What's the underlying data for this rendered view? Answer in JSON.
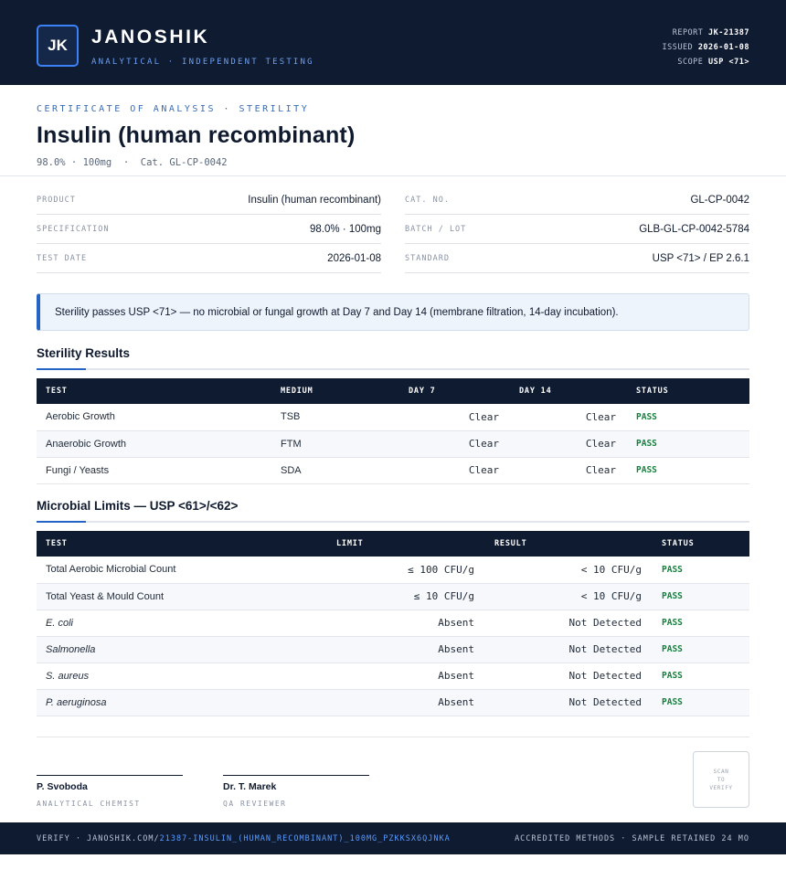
{
  "brand": {
    "logo_text": "JK",
    "name": "JANOSHIK",
    "tagline": "ANALYTICAL · INDEPENDENT TESTING"
  },
  "report_meta": [
    {
      "label": "REPORT",
      "value": "JK-21387"
    },
    {
      "label": "ISSUED",
      "value": "2026-01-08"
    },
    {
      "label": "SCOPE",
      "value": "USP <71>"
    }
  ],
  "certificate": {
    "eyebrow": "CERTIFICATE OF ANALYSIS · STERILITY",
    "title": "Insulin (human recombinant)",
    "subtitle": "98.0% · 100mg  ·  Cat. GL-CP-0042"
  },
  "info": {
    "left": [
      {
        "label": "PRODUCT",
        "value": "Insulin (human recombinant)"
      },
      {
        "label": "SPECIFICATION",
        "value": "98.0% · 100mg"
      },
      {
        "label": "TEST DATE",
        "value": "2026-01-08"
      }
    ],
    "right": [
      {
        "label": "CAT. NO.",
        "value": "GL-CP-0042"
      },
      {
        "label": "BATCH / LOT",
        "value": "GLB-GL-CP-0042-5784"
      },
      {
        "label": "STANDARD",
        "value": "USP <71> / EP 2.6.1"
      }
    ]
  },
  "callout": "Sterility passes USP <71> — no microbial or fungal growth at Day 7 and Day 14 (membrane filtration, 14-day incubation).",
  "sterility": {
    "title": "Sterility Results",
    "headers": [
      "TEST",
      "MEDIUM",
      "DAY 7",
      "DAY 14",
      "STATUS"
    ],
    "rows": [
      {
        "test": "Aerobic Growth",
        "medium": "TSB",
        "day7": "Clear",
        "day14": "Clear",
        "status": "PASS"
      },
      {
        "test": "Anaerobic Growth",
        "medium": "FTM",
        "day7": "Clear",
        "day14": "Clear",
        "status": "PASS"
      },
      {
        "test": "Fungi / Yeasts",
        "medium": "SDA",
        "day7": "Clear",
        "day14": "Clear",
        "status": "PASS"
      }
    ]
  },
  "microbial": {
    "title": "Microbial Limits — USP <61>/<62>",
    "headers": [
      "TEST",
      "LIMIT",
      "RESULT",
      "STATUS"
    ],
    "rows": [
      {
        "test": "Total Aerobic Microbial Count",
        "limit": "≤ 100 CFU/g",
        "result": "< 10 CFU/g",
        "status": "PASS"
      },
      {
        "test": "Total Yeast & Mould Count",
        "limit": "≤ 10 CFU/g",
        "result": "< 10 CFU/g",
        "status": "PASS"
      },
      {
        "test": "E. coli",
        "limit": "Absent",
        "result": "Not Detected",
        "status": "PASS"
      },
      {
        "test": "Salmonella",
        "limit": "Absent",
        "result": "Not Detected",
        "status": "PASS"
      },
      {
        "test": "S. aureus",
        "limit": "Absent",
        "result": "Not Detected",
        "status": "PASS"
      },
      {
        "test": "P. aeruginosa",
        "limit": "Absent",
        "result": "Not Detected",
        "status": "PASS"
      }
    ]
  },
  "signatures": [
    {
      "name": "P. Svoboda",
      "role": "ANALYTICAL CHEMIST"
    },
    {
      "name": "Dr. T. Marek",
      "role": "QA REVIEWER"
    }
  ],
  "qr": {
    "line1": "SCAN",
    "line2": "TO",
    "line3": "VERIFY"
  },
  "footer": {
    "verify_prefix": "VERIFY · JANOSHIK.COM/",
    "verify_path": "21387-INSULIN_(HUMAN_RECOMBINANT)_100MG_PZKKSX6QJNKA",
    "right": "ACCREDITED METHODS · SAMPLE RETAINED 24 MO"
  },
  "colors": {
    "navy": "#0f1b31",
    "accent": "#2563c4",
    "pass": "#15803d"
  }
}
